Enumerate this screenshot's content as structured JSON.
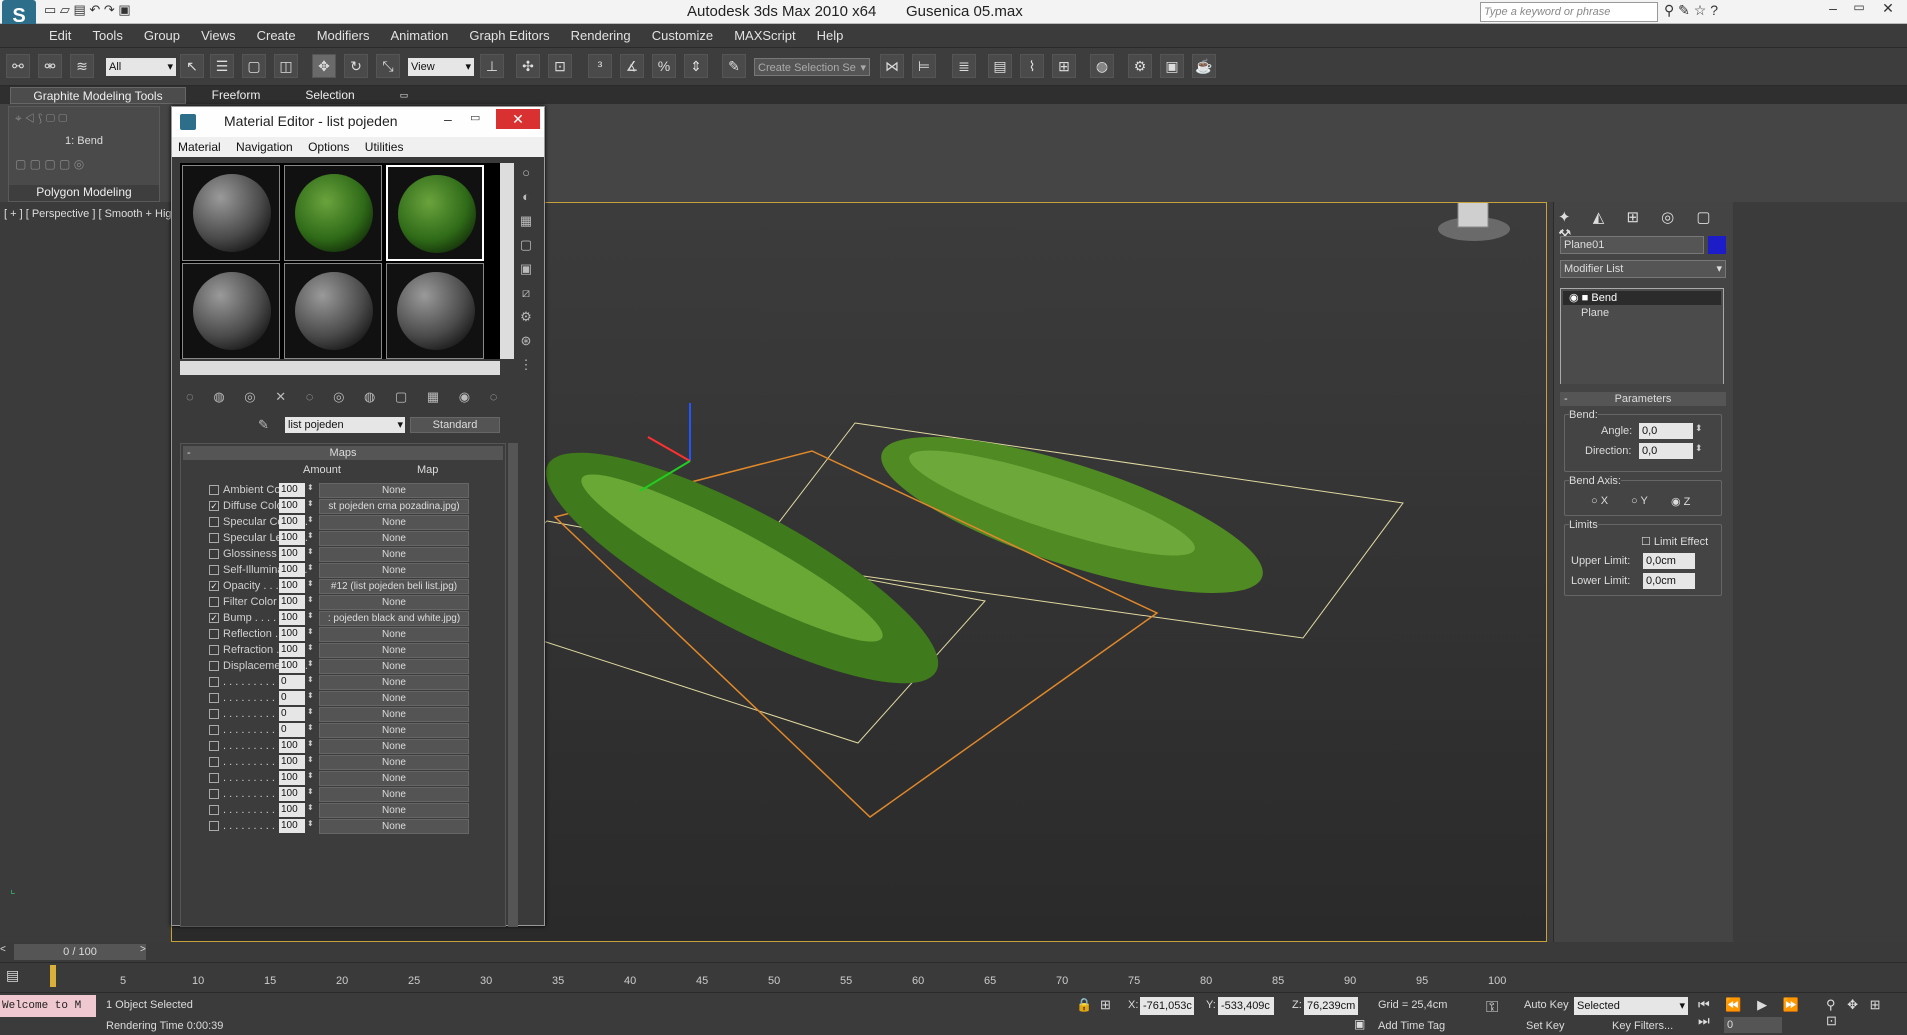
{
  "app": {
    "title": "Autodesk 3ds Max  2010 x64",
    "file": "Gusenica 05.max",
    "search_placeholder": "Type a keyword or phrase"
  },
  "menu": [
    "Edit",
    "Tools",
    "Group",
    "Views",
    "Create",
    "Modifiers",
    "Animation",
    "Graph Editors",
    "Rendering",
    "Customize",
    "MAXScript",
    "Help"
  ],
  "toolbar": {
    "filter": "All",
    "refcoord": "View",
    "selset": "Create Selection Se"
  },
  "ribbon": {
    "tabs": [
      "Graphite Modeling Tools",
      "Freeform",
      "Selection"
    ],
    "modifier": "1: Bend",
    "panel": "Polygon Modeling"
  },
  "viewport": {
    "label": "[ + ] [ Perspective ] [ Smooth + High"
  },
  "material_editor": {
    "title": "Material Editor - list pojeden",
    "menu": [
      "Material",
      "Navigation",
      "Options",
      "Utilities"
    ],
    "material_name": "list pojeden",
    "type": "Standard",
    "rollout": "Maps",
    "col_amount": "Amount",
    "col_map": "Map",
    "rows": [
      {
        "label": "Ambient Color . .",
        "checked": false,
        "amount": "100",
        "map": "None"
      },
      {
        "label": "Diffuse Color . . .",
        "checked": true,
        "amount": "100",
        "map": "st pojeden crna pozadina.jpg)"
      },
      {
        "label": "Specular Color . .",
        "checked": false,
        "amount": "100",
        "map": "None"
      },
      {
        "label": "Specular Level . .",
        "checked": false,
        "amount": "100",
        "map": "None"
      },
      {
        "label": "Glossiness . . . .",
        "checked": false,
        "amount": "100",
        "map": "None"
      },
      {
        "label": "Self-Illumination .",
        "checked": false,
        "amount": "100",
        "map": "None"
      },
      {
        "label": "Opacity . . . . . .",
        "checked": true,
        "amount": "100",
        "map": "#12 (list pojeden beli list.jpg)"
      },
      {
        "label": "Filter Color . . .",
        "checked": false,
        "amount": "100",
        "map": "None"
      },
      {
        "label": "Bump . . . . . . .",
        "checked": true,
        "amount": "100",
        "map": ": pojeden black and white.jpg)"
      },
      {
        "label": "Reflection . . . .",
        "checked": false,
        "amount": "100",
        "map": "None"
      },
      {
        "label": "Refraction . . . .",
        "checked": false,
        "amount": "100",
        "map": "None"
      },
      {
        "label": "Displacement . . .",
        "checked": false,
        "amount": "100",
        "map": "None"
      },
      {
        "label": ". . . . . . . . . .",
        "checked": false,
        "amount": "0",
        "map": "None"
      },
      {
        "label": ". . . . . . . . . .",
        "checked": false,
        "amount": "0",
        "map": "None"
      },
      {
        "label": ". . . . . . . . . .",
        "checked": false,
        "amount": "0",
        "map": "None"
      },
      {
        "label": ". . . . . . . . . .",
        "checked": false,
        "amount": "0",
        "map": "None"
      },
      {
        "label": ". . . . . . . . . .",
        "checked": false,
        "amount": "100",
        "map": "None"
      },
      {
        "label": ". . . . . . . . . .",
        "checked": false,
        "amount": "100",
        "map": "None"
      },
      {
        "label": ". . . . . . . . . .",
        "checked": false,
        "amount": "100",
        "map": "None"
      },
      {
        "label": ". . . . . . . . . .",
        "checked": false,
        "amount": "100",
        "map": "None"
      },
      {
        "label": ". . . . . . . . . .",
        "checked": false,
        "amount": "100",
        "map": "None"
      },
      {
        "label": ". . . . . . . . . .",
        "checked": false,
        "amount": "100",
        "map": "None"
      }
    ]
  },
  "command_panel": {
    "object_name": "Plane01",
    "modifier_list": "Modifier List",
    "stack": [
      "Bend",
      "Plane"
    ],
    "parameters": "Parameters",
    "bend_group": "Bend:",
    "angle_label": "Angle:",
    "angle": "0,0",
    "direction_label": "Direction:",
    "direction": "0,0",
    "axis_group": "Bend Axis:",
    "axes": [
      "X",
      "Y",
      "Z"
    ],
    "limits_group": "Limits",
    "limit_effect": "Limit Effect",
    "upper_label": "Upper Limit:",
    "upper": "0,0cm",
    "lower_label": "Lower Limit:",
    "lower": "0,0cm"
  },
  "timeline": {
    "frame": "0 / 100",
    "ticks": [
      "5",
      "10",
      "15",
      "20",
      "25",
      "30",
      "35",
      "40",
      "45",
      "50",
      "55",
      "60",
      "65",
      "70",
      "75",
      "80",
      "85",
      "90",
      "95",
      "100"
    ]
  },
  "status": {
    "welcome": "Welcome to M",
    "selected": "1 Object Selected",
    "render_time": "Rendering Time  0:00:39",
    "x_label": "X:",
    "x": "-761,053c",
    "y_label": "Y:",
    "y": "-533,409c",
    "z_label": "Z:",
    "z": "76,239cm",
    "grid": "Grid = 25,4cm",
    "add_time_tag": "Add Time Tag",
    "auto_key": "Auto Key",
    "set_key": "Set Key",
    "key_mode": "Selected",
    "key_filters": "Key Filters...",
    "frame_value": "0"
  },
  "colors": {
    "accent_yellow": "#c7a23a",
    "object_swatch": "#1c1cc8",
    "close_red": "#d93131"
  }
}
